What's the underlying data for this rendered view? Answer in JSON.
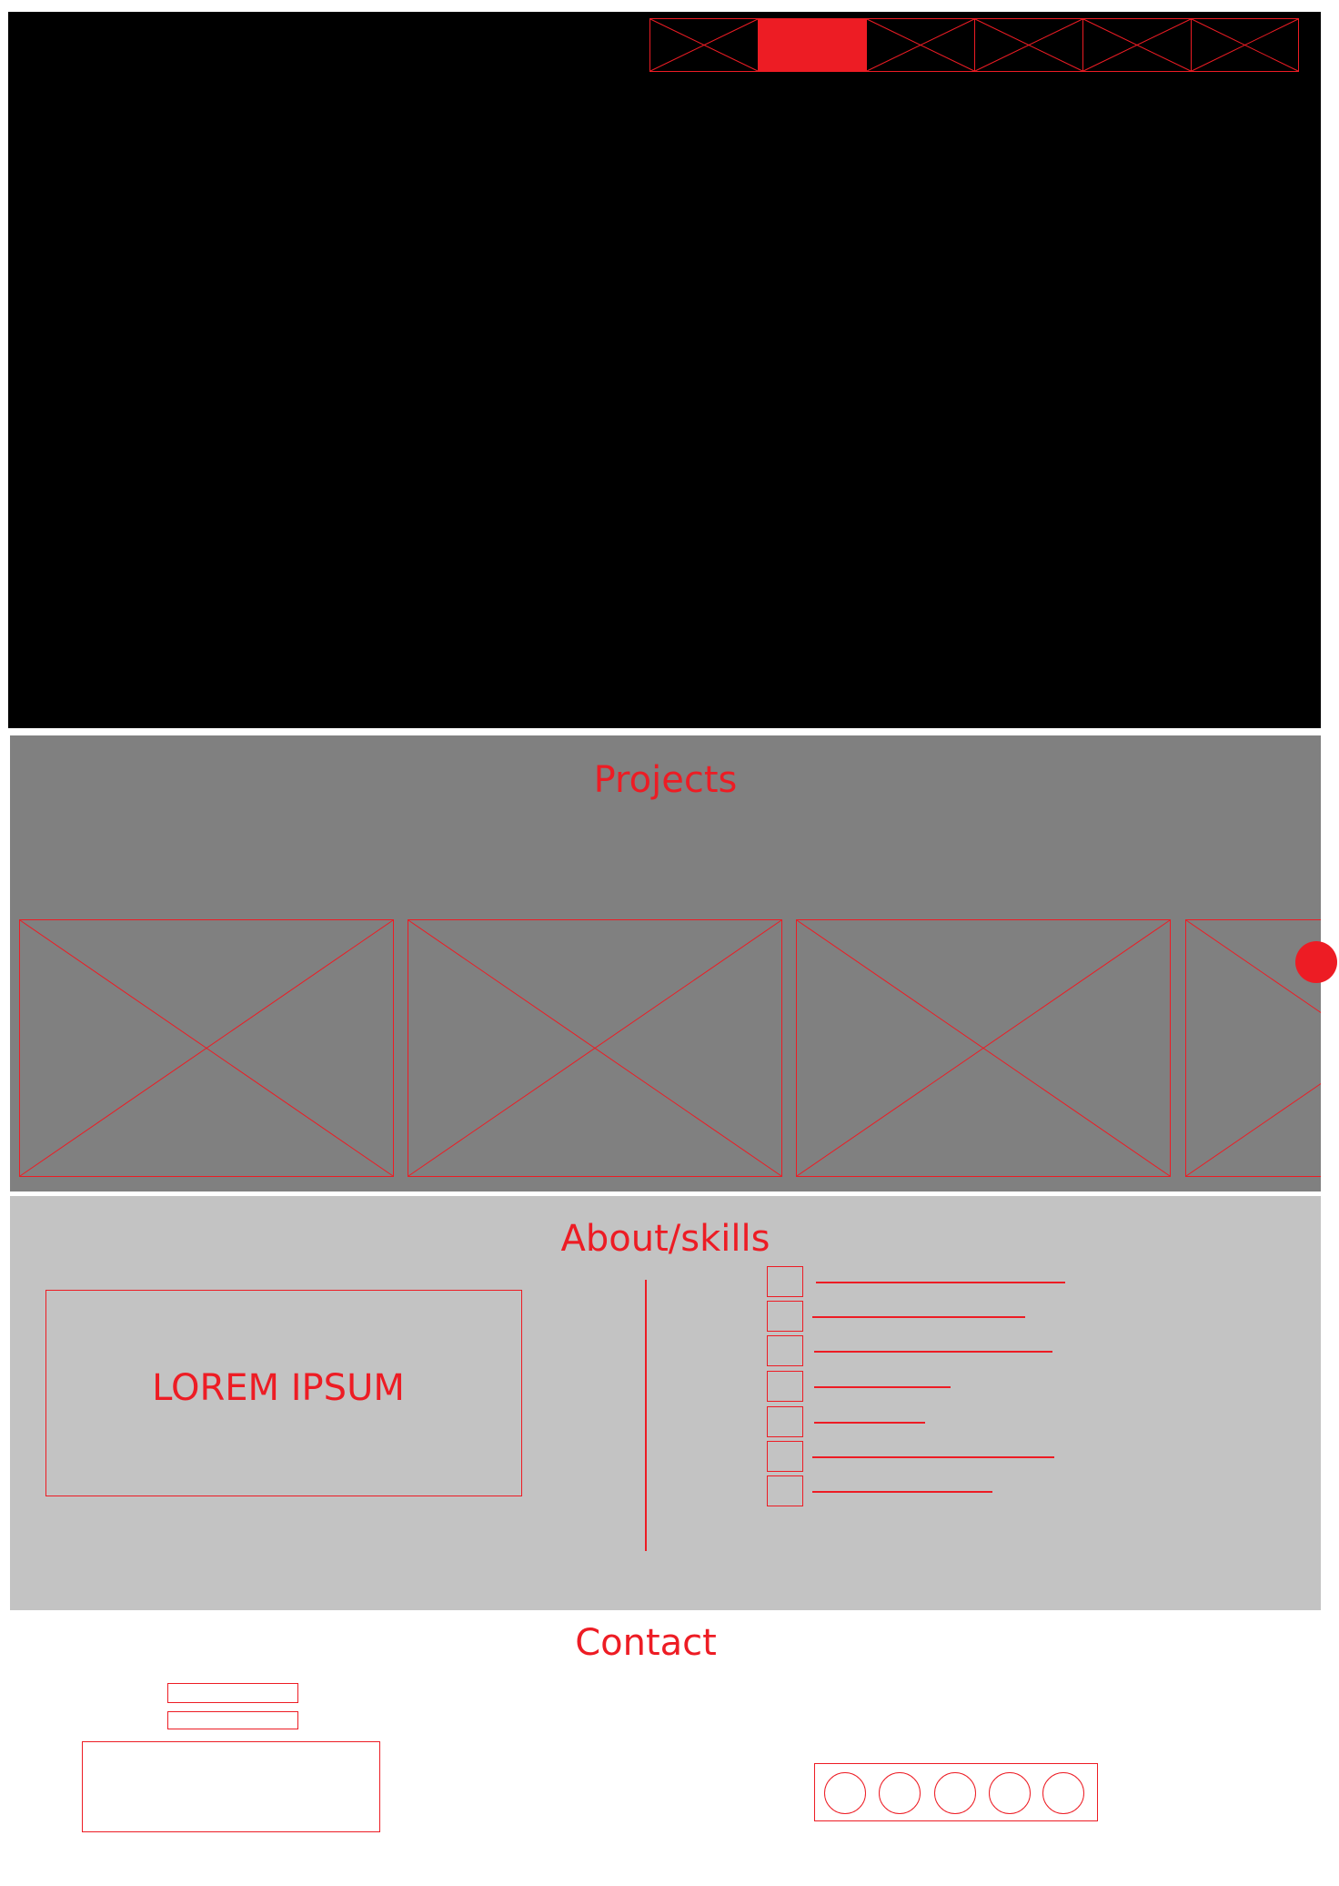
{
  "colors": {
    "accent": "#ed1c24",
    "hero_bg": "#000000",
    "projects_bg": "#808080",
    "about_bg": "#c3c3c3",
    "page_bg": "#ffffff"
  },
  "nav": {
    "items": [
      {
        "icon": "image-placeholder-icon",
        "active": false
      },
      {
        "icon": "active-nav-block",
        "active": true
      },
      {
        "icon": "image-placeholder-icon",
        "active": false
      },
      {
        "icon": "image-placeholder-icon",
        "active": false
      },
      {
        "icon": "image-placeholder-icon",
        "active": false
      },
      {
        "icon": "image-placeholder-icon",
        "active": false
      }
    ]
  },
  "projects": {
    "title": "Projects",
    "cards": [
      "image-placeholder-icon",
      "image-placeholder-icon",
      "image-placeholder-icon",
      "image-placeholder-icon"
    ],
    "scroll_indicator": "red-dot"
  },
  "about": {
    "title": "About/skills",
    "box_text": "LOREM IPSUM",
    "skills_count": 7
  },
  "contact": {
    "title": "Contact",
    "social_count": 5
  }
}
